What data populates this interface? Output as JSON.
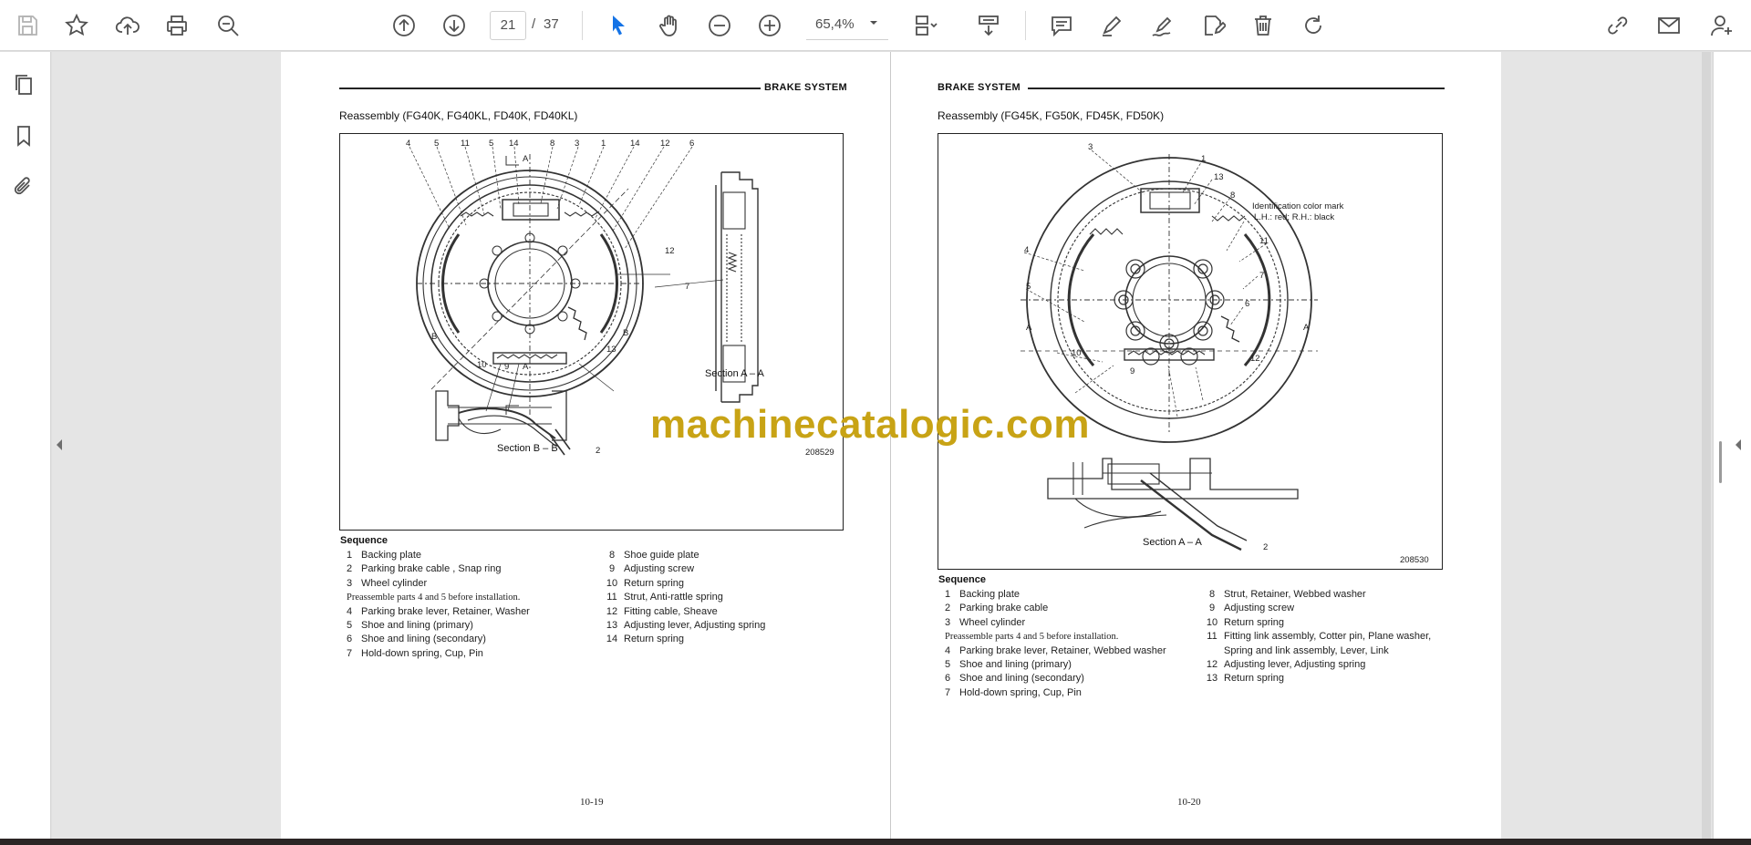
{
  "toolbar": {
    "page_current": "21",
    "page_separator": "/",
    "page_total": "37",
    "zoom": "65,4%"
  },
  "doc": {
    "left": {
      "header": "BRAKE SYSTEM",
      "subtitle": "Reassembly (FG40K, FG40KL, FD40K, FD40KL)",
      "figure_labels": {
        "top": [
          "4",
          "5",
          "11",
          "5",
          "14",
          "8",
          "3",
          "1",
          "14",
          "12",
          "6"
        ],
        "section_marker_a": "A",
        "right_12": "12",
        "left_7": "7",
        "b_left": "B",
        "b_right": "B",
        "n13": "13",
        "n10": "10",
        "n9": "9",
        "n2": "2",
        "section_aa": "Section A – A",
        "section_bb": "Section B – B",
        "code": "208529"
      },
      "sequence_title": "Sequence",
      "sequence_left": [
        {
          "n": "1",
          "t": "Backing plate"
        },
        {
          "n": "2",
          "t": "Parking brake cable , Snap ring"
        },
        {
          "n": "3",
          "t": "Wheel cylinder"
        },
        {
          "n": "",
          "t": "Preassemble parts 4 and 5 before installation."
        },
        {
          "n": "4",
          "t": "Parking brake lever, Retainer, Washer"
        },
        {
          "n": "5",
          "t": "Shoe and lining (primary)"
        },
        {
          "n": "6",
          "t": "Shoe and lining (secondary)"
        },
        {
          "n": "7",
          "t": "Hold-down spring, Cup, Pin"
        }
      ],
      "sequence_right": [
        {
          "n": "8",
          "t": "Shoe guide plate"
        },
        {
          "n": "9",
          "t": "Adjusting screw"
        },
        {
          "n": "10",
          "t": "Return spring"
        },
        {
          "n": "11",
          "t": "Strut, Anti-rattle spring"
        },
        {
          "n": "12",
          "t": "Fitting cable, Sheave"
        },
        {
          "n": "13",
          "t": "Adjusting lever, Adjusting spring"
        },
        {
          "n": "14",
          "t": "Return spring"
        }
      ],
      "page_number": "10-19"
    },
    "right": {
      "header": "BRAKE SYSTEM",
      "subtitle": "Reassembly (FG45K, FG50K, FD45K, FD50K)",
      "figure_labels": {
        "n3": "3",
        "n1": "1",
        "n13": "13",
        "n8": "8",
        "id_mark_1": "Identification color mark",
        "id_mark_2": "L.H.: red; R.H.: black",
        "n11": "11",
        "n4": "4",
        "n7": "7",
        "n5": "5",
        "n6": "6",
        "a_left": "A",
        "a_right": "A",
        "n10": "10",
        "n12": "12",
        "n9": "9",
        "n2": "2",
        "section_aa": "Section A – A",
        "code": "208530"
      },
      "sequence_title": "Sequence",
      "sequence_left": [
        {
          "n": "1",
          "t": "Backing plate"
        },
        {
          "n": "2",
          "t": "Parking brake cable"
        },
        {
          "n": "3",
          "t": "Wheel cylinder"
        },
        {
          "n": "",
          "t": "Preassemble parts 4 and 5 before installation."
        },
        {
          "n": "4",
          "t": "Parking brake lever, Retainer, Webbed washer"
        },
        {
          "n": "5",
          "t": "Shoe and lining (primary)"
        },
        {
          "n": "6",
          "t": "Shoe and lining (secondary)"
        },
        {
          "n": "7",
          "t": "Hold-down spring, Cup, Pin"
        }
      ],
      "sequence_right": [
        {
          "n": "8",
          "t": "Strut, Retainer, Webbed washer"
        },
        {
          "n": "9",
          "t": "Adjusting screw"
        },
        {
          "n": "10",
          "t": "Return spring"
        },
        {
          "n": "11",
          "t": "Fitting link assembly, Cotter pin, Plane washer,"
        },
        {
          "n": "",
          "t": "Spring and link assembly, Lever, Link"
        },
        {
          "n": "12",
          "t": "Adjusting lever, Adjusting spring"
        },
        {
          "n": "13",
          "t": "Return spring"
        }
      ],
      "page_number": "10-20"
    }
  },
  "watermark": "machinecatalogic.com"
}
